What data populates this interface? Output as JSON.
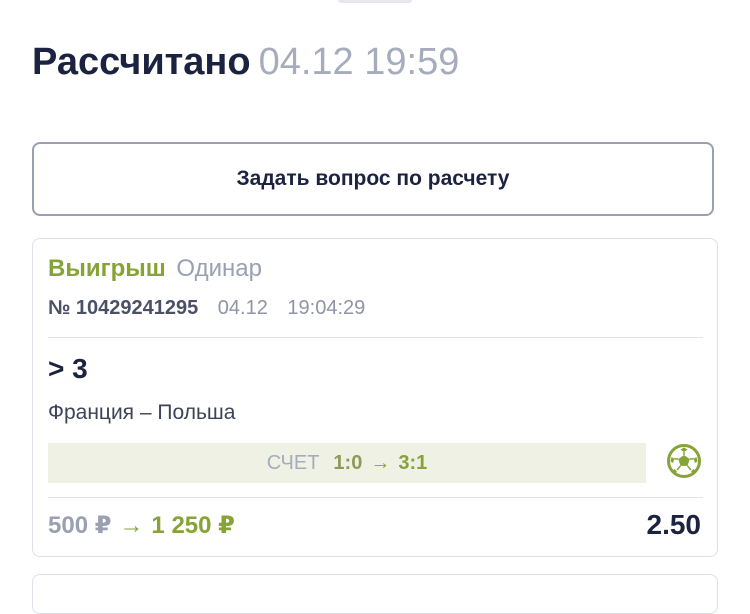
{
  "header": {
    "status": "Рассчитано",
    "datetime": "04.12 19:59"
  },
  "ask_button": {
    "label": "Задать вопрос по расчету"
  },
  "bet": {
    "result": "Выигрыш",
    "type": "Одинар",
    "number": "№ 10429241295",
    "date": "04.12",
    "time": "19:04:29",
    "selection": "> 3",
    "event": "Франция – Польша",
    "score_label": "СЧЕТ",
    "score_from": "1:0",
    "score_arrow": "→",
    "score_to": "3:1",
    "sport_icon": "soccer-ball-icon",
    "stake": "500 ₽",
    "payout_arrow": "→",
    "payout": "1 250 ₽",
    "odds": "2.50"
  },
  "colors": {
    "accent_green": "#86a337",
    "text_dark": "#1b2340",
    "text_muted": "#9aa0b1",
    "score_bg": "#eef1e3"
  }
}
